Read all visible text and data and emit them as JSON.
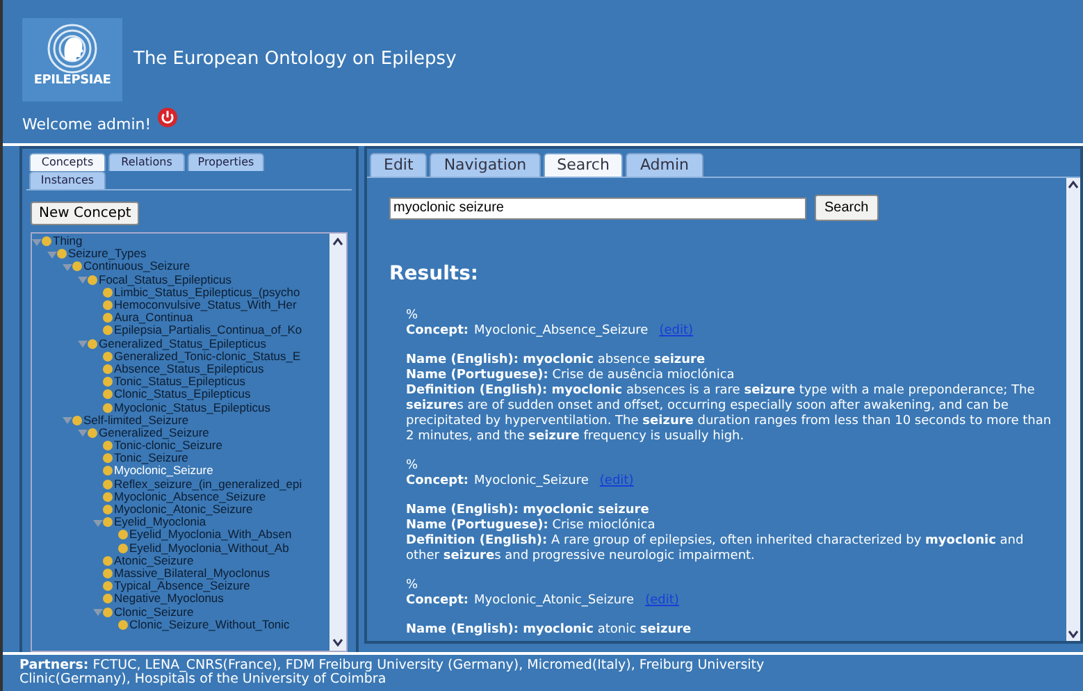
{
  "header": {
    "logo_text": "EPILEPSIAE",
    "title": "The European Ontology on Epilepsy",
    "welcome": "Welcome admin!"
  },
  "left_tabs": [
    {
      "label": "Concepts",
      "selected": true
    },
    {
      "label": "Relations",
      "selected": false
    },
    {
      "label": "Properties",
      "selected": false
    },
    {
      "label": "Instances",
      "selected": false
    }
  ],
  "new_concept_button": "New Concept",
  "tree": [
    {
      "label": "Thing",
      "expanded": true,
      "selected": false,
      "children": [
        {
          "label": "Seizure_Types",
          "expanded": true,
          "selected": false,
          "children": [
            {
              "label": "Continuous_Seizure",
              "expanded": true,
              "selected": false,
              "children": [
                {
                  "label": "Focal_Status_Epilepticus",
                  "expanded": true,
                  "selected": false,
                  "children": [
                    {
                      "label": "Limbic_Status_Epilepticus_(psycho",
                      "expanded": false,
                      "selected": false
                    },
                    {
                      "label": "Hemoconvulsive_Status_With_Her",
                      "expanded": false,
                      "selected": false
                    },
                    {
                      "label": "Aura_Continua",
                      "expanded": false,
                      "selected": false
                    },
                    {
                      "label": "Epilepsia_Partialis_Continua_of_Ko",
                      "expanded": false,
                      "selected": false
                    }
                  ]
                },
                {
                  "label": "Generalized_Status_Epilepticus",
                  "expanded": true,
                  "selected": false,
                  "children": [
                    {
                      "label": "Generalized_Tonic-clonic_Status_E",
                      "expanded": false,
                      "selected": false
                    },
                    {
                      "label": "Absence_Status_Epilepticus",
                      "expanded": false,
                      "selected": false
                    },
                    {
                      "label": "Tonic_Status_Epilepticus",
                      "expanded": false,
                      "selected": false
                    },
                    {
                      "label": "Clonic_Status_Epilepticus",
                      "expanded": false,
                      "selected": false
                    },
                    {
                      "label": "Myoclonic_Status_Epilepticus",
                      "expanded": false,
                      "selected": false
                    }
                  ]
                }
              ]
            },
            {
              "label": "Self-limited_Seizure",
              "expanded": true,
              "selected": false,
              "children": [
                {
                  "label": "Generalized_Seizure",
                  "expanded": true,
                  "selected": false,
                  "children": [
                    {
                      "label": "Tonic-clonic_Seizure",
                      "expanded": false,
                      "selected": false
                    },
                    {
                      "label": "Tonic_Seizure",
                      "expanded": false,
                      "selected": false
                    },
                    {
                      "label": "Myoclonic_Seizure",
                      "expanded": false,
                      "selected": true
                    },
                    {
                      "label": "Reflex_seizure_(in_generalized_epi",
                      "expanded": false,
                      "selected": false
                    },
                    {
                      "label": "Myoclonic_Absence_Seizure",
                      "expanded": false,
                      "selected": false
                    },
                    {
                      "label": "Myoclonic_Atonic_Seizure",
                      "expanded": false,
                      "selected": false
                    },
                    {
                      "label": "Eyelid_Myoclonia",
                      "expanded": true,
                      "selected": false,
                      "children": [
                        {
                          "label": "Eyelid_Myoclonia_With_Absen",
                          "expanded": false,
                          "selected": false
                        },
                        {
                          "label": "Eyelid_Myoclonia_Without_Ab",
                          "expanded": false,
                          "selected": false
                        }
                      ]
                    },
                    {
                      "label": "Atonic_Seizure",
                      "expanded": false,
                      "selected": false
                    },
                    {
                      "label": "Massive_Bilateral_Myoclonus",
                      "expanded": false,
                      "selected": false
                    },
                    {
                      "label": "Typical_Absence_Seizure",
                      "expanded": false,
                      "selected": false
                    },
                    {
                      "label": "Negative_Myoclonus",
                      "expanded": false,
                      "selected": false
                    },
                    {
                      "label": "Clonic_Seizure",
                      "expanded": true,
                      "selected": false,
                      "children": [
                        {
                          "label": "Clonic_Seizure_Without_Tonic",
                          "expanded": false,
                          "selected": false
                        }
                      ]
                    }
                  ]
                }
              ]
            }
          ]
        }
      ]
    }
  ],
  "right_tabs": [
    {
      "label": "Edit",
      "selected": false
    },
    {
      "label": "Navigation",
      "selected": false
    },
    {
      "label": "Search",
      "selected": true
    },
    {
      "label": "Admin",
      "selected": false
    }
  ],
  "search": {
    "value": "myoclonic seizure",
    "button": "Search"
  },
  "results_heading": "Results:",
  "results": [
    {
      "marker": "%",
      "concept_label": "Concept:",
      "concept": "Myoclonic_Absence_Seizure",
      "edit": "(edit)",
      "lines": [
        "**Name (English): myoclonic** absence **seizure**",
        "**Name (Portuguese):** Crise de ausência mioclónica",
        "**Definition (English): myoclonic** absences is a rare **seizure** type with a male preponderance; The **seizure**s are of sudden onset and offset, occurring especially soon after awakening, and can be precipitated by hyperventilation. The **seizure** duration ranges from less than 10 seconds to more than 2 minutes, and the **seizure** frequency is usually high."
      ]
    },
    {
      "marker": "%",
      "concept_label": "Concept:",
      "concept": "Myoclonic_Seizure",
      "edit": "(edit)",
      "lines": [
        "**Name (English): myoclonic seizure**",
        "**Name (Portuguese):** Crise mioclónica",
        "**Definition (English):** A rare group of epilepsies, often inherited characterized by **myoclonic** and other **seizure**s and progressive neurologic impairment."
      ]
    },
    {
      "marker": "%",
      "concept_label": "Concept:",
      "concept": "Myoclonic_Atonic_Seizure",
      "edit": "(edit)",
      "lines": [
        "**Name (English): myoclonic** atonic **seizure**"
      ]
    }
  ],
  "footer": {
    "partners": "**Partners:** FCTUC, LENA_CNRS(France), FDM Freiburg University (Germany), Micromed(Italy), Freiburg University Clinic(Germany), Hospitals of the University of Coimbra"
  }
}
